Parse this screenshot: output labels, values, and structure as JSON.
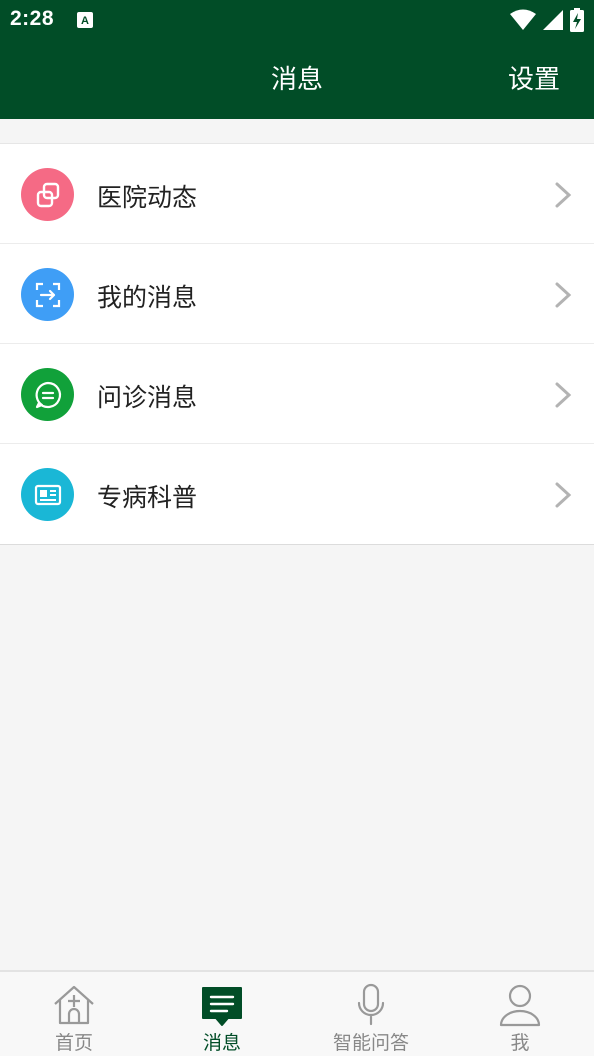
{
  "status_bar": {
    "time": "2:28"
  },
  "header": {
    "title": "消息",
    "settings_label": "设置"
  },
  "list": {
    "items": [
      {
        "label": "医院动态",
        "icon": "hospital-news-icon",
        "color": "#f56a85"
      },
      {
        "label": "我的消息",
        "icon": "my-message-icon",
        "color": "#3f9ef6"
      },
      {
        "label": "问诊消息",
        "icon": "consult-chat-icon",
        "color": "#11a13a"
      },
      {
        "label": "专病科普",
        "icon": "science-news-icon",
        "color": "#1ab7d6"
      }
    ]
  },
  "tabbar": {
    "tabs": [
      {
        "label": "首页",
        "icon": "home-icon",
        "active": false
      },
      {
        "label": "消息",
        "icon": "message-icon",
        "active": true
      },
      {
        "label": "智能问答",
        "icon": "microphone-icon",
        "active": false
      },
      {
        "label": "我",
        "icon": "person-icon",
        "active": false
      }
    ]
  },
  "colors": {
    "brand": "#014d27",
    "background": "#f5f5f5",
    "inactive_tab": "#888888"
  }
}
